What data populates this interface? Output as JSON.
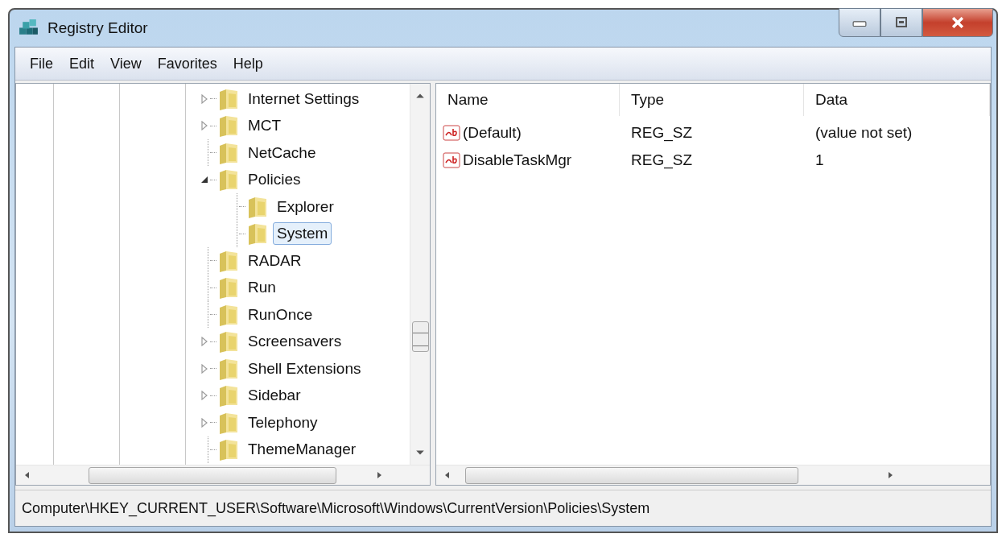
{
  "window": {
    "title": "Registry Editor"
  },
  "menu": [
    "File",
    "Edit",
    "View",
    "Favorites",
    "Help"
  ],
  "tree": {
    "items": [
      {
        "label": "Internet Settings",
        "kind": "branch",
        "expanded": false,
        "selected": false
      },
      {
        "label": "MCT",
        "kind": "branch",
        "expanded": false,
        "selected": false
      },
      {
        "label": "NetCache",
        "kind": "leaf",
        "selected": false
      },
      {
        "label": "Policies",
        "kind": "branch",
        "expanded": true,
        "selected": false,
        "children": [
          {
            "label": "Explorer",
            "kind": "leaf",
            "selected": false
          },
          {
            "label": "System",
            "kind": "leaf",
            "selected": true
          }
        ]
      },
      {
        "label": "RADAR",
        "kind": "leaf",
        "selected": false
      },
      {
        "label": "Run",
        "kind": "leaf",
        "selected": false
      },
      {
        "label": "RunOnce",
        "kind": "leaf",
        "selected": false
      },
      {
        "label": "Screensavers",
        "kind": "branch",
        "expanded": false,
        "selected": false
      },
      {
        "label": "Shell Extensions",
        "kind": "branch",
        "expanded": false,
        "selected": false
      },
      {
        "label": "Sidebar",
        "kind": "branch",
        "expanded": false,
        "selected": false
      },
      {
        "label": "Telephony",
        "kind": "branch",
        "expanded": false,
        "selected": false
      },
      {
        "label": "ThemeManager",
        "kind": "leaf",
        "selected": false
      }
    ]
  },
  "values": {
    "columns": [
      "Name",
      "Type",
      "Data"
    ],
    "rows": [
      {
        "name": "(Default)",
        "type": "REG_SZ",
        "data": "(value not set)"
      },
      {
        "name": "DisableTaskMgr",
        "type": "REG_SZ",
        "data": "1"
      }
    ]
  },
  "status_bar": "Computer\\HKEY_CURRENT_USER\\Software\\Microsoft\\Windows\\CurrentVersion\\Policies\\System"
}
